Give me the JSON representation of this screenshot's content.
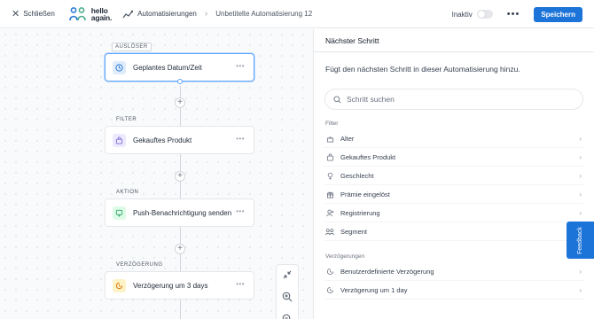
{
  "header": {
    "close_label": "Schließen",
    "logo_text_line1": "hello",
    "logo_text_line2": "again.",
    "breadcrumb_root": "Automatisierungen",
    "breadcrumb_current": "Unbetitelte Automatisierung 12",
    "status_label": "Inaktiv",
    "status_active": false,
    "save_label": "Speichern"
  },
  "canvas": {
    "nodes": [
      {
        "tag": "AUSLÖSER",
        "label": "Geplantes Datum/Zeit",
        "icon": "clock-icon",
        "selected": true
      },
      {
        "tag": "FILTER",
        "label": "Gekauftes Produkt",
        "icon": "shopping-bag-icon",
        "selected": false
      },
      {
        "tag": "AKTION",
        "label": "Push-Benachrichtigung senden",
        "icon": "push-notification-icon",
        "selected": false
      },
      {
        "tag": "VERZÖGERUNG",
        "label": "Verzögerung um 3 days",
        "icon": "delay-icon",
        "selected": false
      }
    ],
    "zoom_controls": [
      "fit-view-icon",
      "zoom-in-icon",
      "zoom-out-icon"
    ]
  },
  "panel": {
    "title": "Nächster Schritt",
    "description": "Fügt den nächsten Schritt in dieser Automatisierung hinzu.",
    "search_placeholder": "Schritt suchen",
    "filter_section": "Filter",
    "filter_items": [
      {
        "label": "Alter",
        "icon": "age-icon"
      },
      {
        "label": "Gekauftes Produkt",
        "icon": "shopping-bag-icon"
      },
      {
        "label": "Geschlecht",
        "icon": "gender-icon"
      },
      {
        "label": "Prämie eingelöst",
        "icon": "gift-icon"
      },
      {
        "label": "Registrierung",
        "icon": "user-plus-icon"
      },
      {
        "label": "Segment",
        "icon": "segment-icon"
      }
    ],
    "delay_section": "Verzögerungen",
    "delay_items": [
      {
        "label": "Benutzerdefinierte Verzögerung",
        "icon": "delay-icon"
      },
      {
        "label": "Verzögerung um 1 day",
        "icon": "delay-icon"
      }
    ]
  },
  "feedback_label": "Feedback",
  "colors": {
    "primary": "#1d74d8",
    "selected_border": "#60a5fa",
    "logo_blue": "#2b7bd4",
    "logo_green": "#4cae8f"
  }
}
